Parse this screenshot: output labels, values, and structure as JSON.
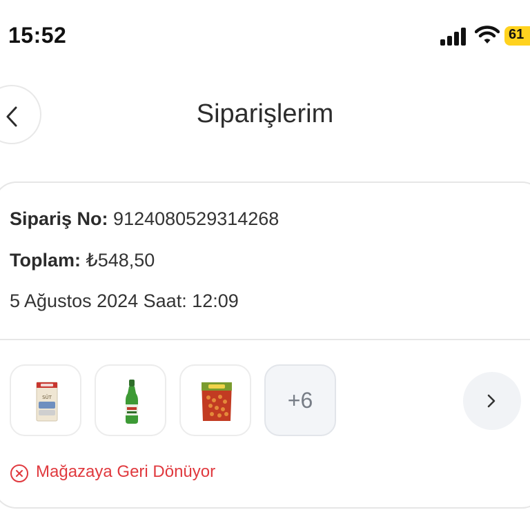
{
  "status_bar": {
    "time": "15:52",
    "battery": "61",
    "icons": [
      "cellular-signal-icon",
      "wifi-icon",
      "battery-icon"
    ]
  },
  "header": {
    "title": "Siparişlerim",
    "back_icon": "chevron-left-icon"
  },
  "order": {
    "number_label": "Sipariş No:",
    "number_value": "9124080529314268",
    "total_label": "Toplam:",
    "total_value": "₺548,50",
    "date": "5 Ağustos 2024 Saat: 12:09",
    "products": [
      {
        "icon": "milk-carton-icon",
        "text": "SÜT"
      },
      {
        "icon": "green-bottle-icon"
      },
      {
        "icon": "snack-pack-icon"
      }
    ],
    "more_count": "+6",
    "next_icon": "chevron-right-icon",
    "status_icon": "cancel-circle-icon",
    "status_text": "Mağazaya Geri Dönüyor",
    "status_color": "#e0393e"
  },
  "colors": {
    "battery": "#ffd21f",
    "border": "#e6e6e6",
    "more_bg": "#f3f5f8"
  }
}
